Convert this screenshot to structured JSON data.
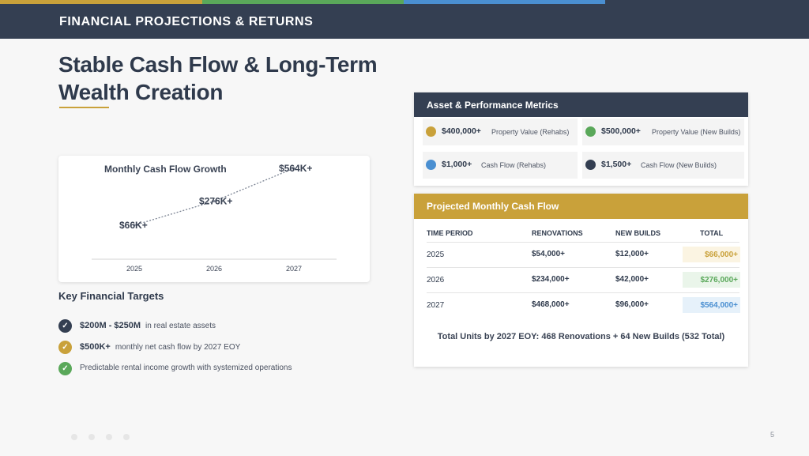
{
  "colors": {
    "navy": "#343f52",
    "gold": "#c9a13a",
    "green": "#5aa85a",
    "blue": "#4a8fd1",
    "stripe": [
      "#c9a13a",
      "#5aa85a",
      "#4a8fd1",
      "#343f52"
    ]
  },
  "header": {
    "title": "FINANCIAL PROJECTIONS & RETURNS"
  },
  "page_title": "Stable Cash Flow & Long-Term Wealth Creation",
  "chart_data": {
    "type": "line",
    "title": "Monthly Cash Flow Growth",
    "categories": [
      "2025",
      "2026",
      "2027"
    ],
    "values": [
      66,
      276,
      564
    ],
    "data_labels": [
      "$66K+",
      "$276K+",
      "$564K+"
    ],
    "unit": "$K",
    "line_style": "dotted",
    "grid": false
  },
  "targets": {
    "heading": "Key Financial Targets",
    "items": [
      {
        "icon": "check-icon",
        "color": "#343f52",
        "bold": "$200M - $250M",
        "text": "in real estate assets"
      },
      {
        "icon": "check-icon",
        "color": "#c9a13a",
        "bold": "$500K+",
        "text": "monthly net cash flow by 2027 EOY"
      },
      {
        "icon": "check-icon",
        "color": "#5aa85a",
        "bold": "",
        "text": "Predictable rental income growth with systemized operations"
      }
    ]
  },
  "metrics": {
    "heading": "Asset & Performance Metrics",
    "items": [
      {
        "value": "$400,000+",
        "label": "Property Value (Rehabs)",
        "color": "#c9a13a"
      },
      {
        "value": "$500,000+",
        "label": "Property Value (New Builds)",
        "color": "#5aa85a"
      },
      {
        "value": "$1,000+",
        "label": "Cash Flow (Rehabs)",
        "color": "#4a8fd1"
      },
      {
        "value": "$1,500+",
        "label": "Cash Flow (New Builds)",
        "color": "#343f52"
      }
    ]
  },
  "cashflow": {
    "heading": "Projected Monthly Cash Flow",
    "columns": [
      "TIME PERIOD",
      "RENOVATIONS",
      "NEW BUILDS",
      "TOTAL"
    ],
    "rows": [
      {
        "period": "2025",
        "renovations": "$54,000+",
        "new_builds": "$12,000+",
        "total": "$66,000+",
        "total_color": "#c9a13a",
        "total_bg": "#fbf4e2"
      },
      {
        "period": "2026",
        "renovations": "$234,000+",
        "new_builds": "$42,000+",
        "total": "$276,000+",
        "total_color": "#5aa85a",
        "total_bg": "#eaf5ea"
      },
      {
        "period": "2027",
        "renovations": "$468,000+",
        "new_builds": "$96,000+",
        "total": "$564,000+",
        "total_color": "#4a8fd1",
        "total_bg": "#e6f1fa"
      }
    ],
    "summary": "Total Units by 2027 EOY: 468 Renovations + 64 New Builds (532 Total)"
  },
  "page_number": "5"
}
